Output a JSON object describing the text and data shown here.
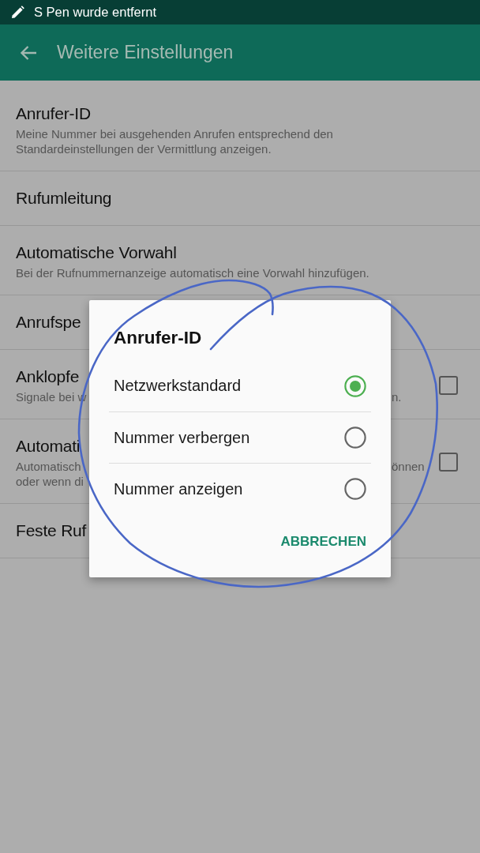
{
  "status_bar": {
    "notification": "S Pen wurde entfernt"
  },
  "app_bar": {
    "title": "Weitere Einstellungen"
  },
  "settings": [
    {
      "kind": "text",
      "title": "Anrufer-ID",
      "subtitle": "Meine Nummer bei ausgehenden Anrufen entsprechend den Standardeinstellungen der Vermittlung anzeigen."
    },
    {
      "kind": "text",
      "title": "Rufumleitung"
    },
    {
      "kind": "text",
      "title": "Automatische Vorwahl",
      "subtitle": "Bei der Rufnummernanzeige automatisch eine Vorwahl hinzufügen."
    },
    {
      "kind": "text",
      "title": "Anrufspe"
    },
    {
      "kind": "checkbox",
      "title": "Anklopfe",
      "subtitle_lines": [
        "Signale bei w"
      ],
      "subtitle_right": "n.",
      "checked": false
    },
    {
      "kind": "checkbox",
      "title": "Automati",
      "subtitle_lines": [
        "Automatisch",
        "oder wenn di"
      ],
      "subtitle_right": "önnen",
      "checked": false
    },
    {
      "kind": "text",
      "title": "Feste Ruf"
    }
  ],
  "dialog": {
    "title": "Anrufer-ID",
    "options": [
      {
        "label": "Netzwerkstandard",
        "selected": true
      },
      {
        "label": "Nummer verbergen",
        "selected": false
      },
      {
        "label": "Nummer anzeigen",
        "selected": false
      }
    ],
    "buttons": [
      "ABBRECHEN"
    ]
  }
}
